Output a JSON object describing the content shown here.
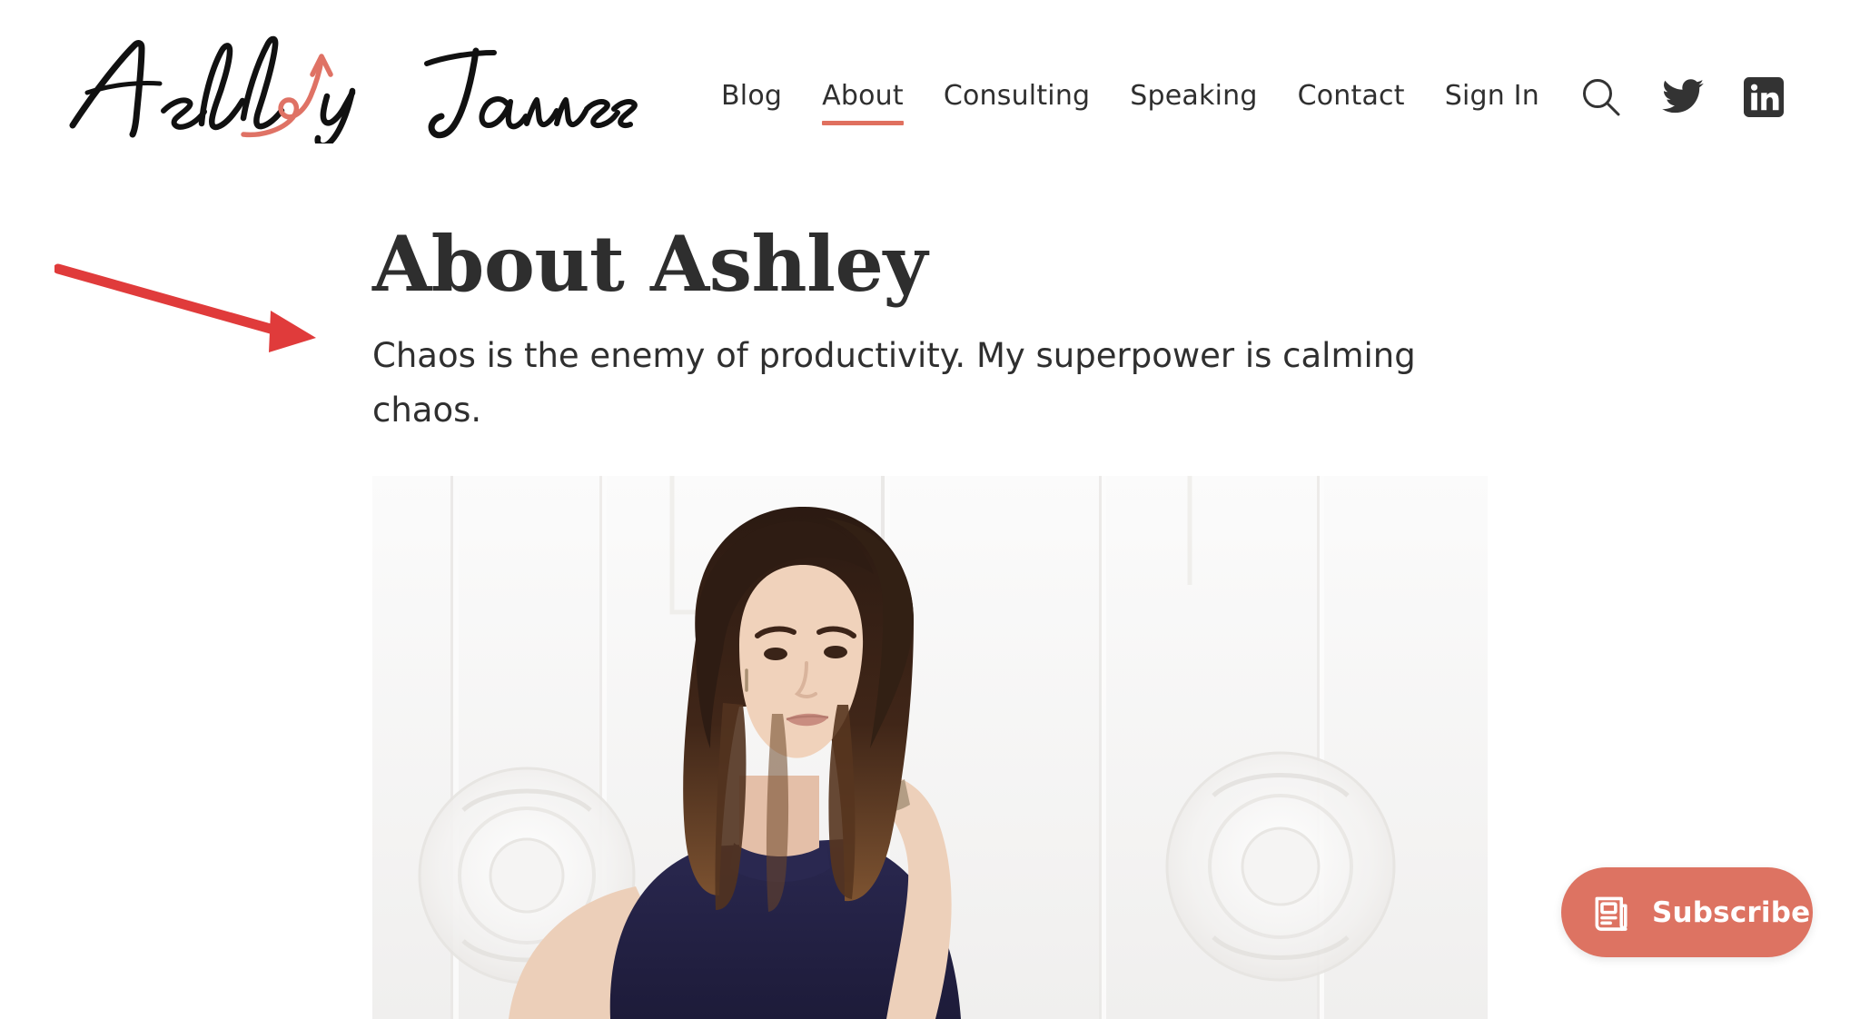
{
  "site": {
    "brand_name": "Ashley Janssen",
    "brand_logo_icon": "script-signature-logo",
    "accent_color": "#e0705f",
    "text_color": "#2f2f2f",
    "background_color": "#ffffff"
  },
  "header": {
    "nav": [
      {
        "label": "Blog",
        "active": false
      },
      {
        "label": "About",
        "active": true
      },
      {
        "label": "Consulting",
        "active": false
      },
      {
        "label": "Speaking",
        "active": false
      },
      {
        "label": "Contact",
        "active": false
      },
      {
        "label": "Sign In",
        "active": false
      }
    ],
    "icons": [
      {
        "name": "search-icon",
        "label": "Search"
      },
      {
        "name": "twitter-icon",
        "label": "Twitter"
      },
      {
        "name": "linkedin-icon",
        "label": "LinkedIn"
      }
    ]
  },
  "main": {
    "title": "About Ashley",
    "subtitle": "Chaos is the enemy of productivity. My superpower is calming chaos.",
    "hero_photo": {
      "name": "ashley-portrait-photo",
      "description": "Portrait of a woman with long dark brown ombre hair wearing a navy sleeveless mock-neck top, hand raised to her hair, standing in front of a white paneled wall with circular medallion relief",
      "wall_color": "#f4f4f3",
      "top_color": "#262445",
      "hair_color": "#3a2319",
      "skin_color": "#e9c7b2"
    }
  },
  "annotation": {
    "name": "red-arrow-annotation",
    "color": "#e03b3b",
    "points_to": "page subtitle"
  },
  "subscribe": {
    "label": "Subscribe",
    "icon": "newspaper-icon",
    "background_color": "#dd7362",
    "text_color": "#ffffff"
  }
}
